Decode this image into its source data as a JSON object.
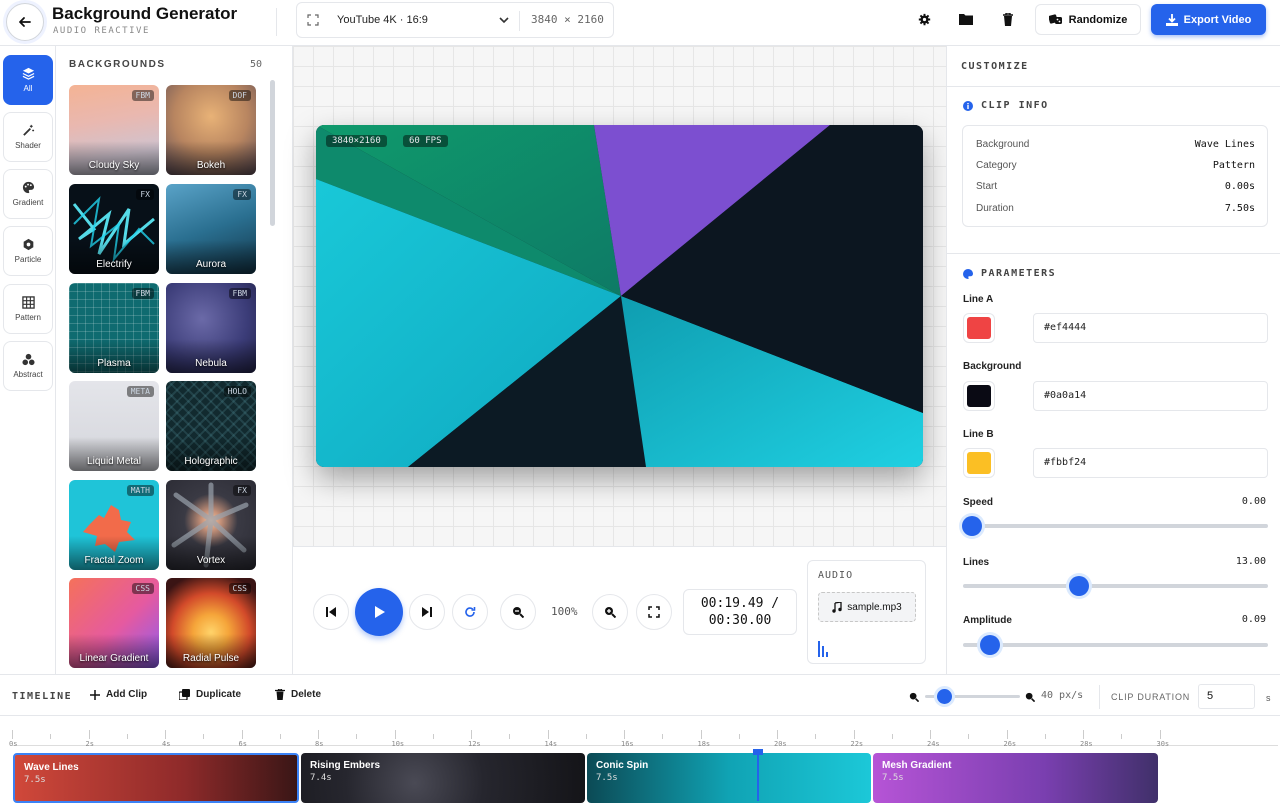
{
  "header": {
    "title": "Background Generator",
    "subtitle": "AUDIO REACTIVE",
    "preset": "YouTube 4K · 16:9",
    "resolution": "3840 × 2160",
    "randomize_label": "Randomize",
    "export_label": "Export Video"
  },
  "categories": [
    {
      "label": "All",
      "icon": "layers-icon",
      "active": true
    },
    {
      "label": "Shader",
      "icon": "wand-icon"
    },
    {
      "label": "Gradient",
      "icon": "palette-icon"
    },
    {
      "label": "Particle",
      "icon": "atom-icon"
    },
    {
      "label": "Pattern",
      "icon": "grid-icon"
    },
    {
      "label": "Abstract",
      "icon": "shapes-icon"
    }
  ],
  "backgrounds": {
    "title": "BACKGROUNDS",
    "count": "50",
    "items": [
      {
        "name": "Cloudy Sky",
        "tag": "FBM"
      },
      {
        "name": "Bokeh",
        "tag": "DOF"
      },
      {
        "name": "Electrify",
        "tag": "FX"
      },
      {
        "name": "Aurora",
        "tag": "FX"
      },
      {
        "name": "Plasma",
        "tag": "FBM"
      },
      {
        "name": "Nebula",
        "tag": "FBM"
      },
      {
        "name": "Liquid Metal",
        "tag": "META"
      },
      {
        "name": "Holographic",
        "tag": "HOLO"
      },
      {
        "name": "Fractal Zoom",
        "tag": "MATH"
      },
      {
        "name": "Vortex",
        "tag": "FX"
      },
      {
        "name": "Linear Gradient",
        "tag": "CSS"
      },
      {
        "name": "Radial Pulse",
        "tag": "CSS"
      }
    ]
  },
  "preview": {
    "res_badge": "3840×2160",
    "fps_badge": "60 FPS"
  },
  "playback": {
    "zoom": "100%",
    "current_time": "00:19.49 /",
    "total_time": "00:30.00",
    "audio_title": "AUDIO",
    "audio_file": "sample.mp3"
  },
  "customize": {
    "title": "CUSTOMIZE",
    "clip_info_title": "CLIP INFO",
    "clip_info": [
      {
        "label": "Background",
        "value": "Wave Lines"
      },
      {
        "label": "Category",
        "value": "Pattern"
      },
      {
        "label": "Start",
        "value": "0.00s"
      },
      {
        "label": "Duration",
        "value": "7.50s"
      }
    ],
    "params_title": "PARAMETERS",
    "colors": [
      {
        "label": "Line A",
        "hex": "#ef4444"
      },
      {
        "label": "Background",
        "hex": "#0a0a14"
      },
      {
        "label": "Line B",
        "hex": "#fbbf24"
      }
    ],
    "sliders": [
      {
        "label": "Speed",
        "value": "0.00",
        "fraction": 0.03
      },
      {
        "label": "Lines",
        "value": "13.00",
        "fraction": 0.38
      },
      {
        "label": "Amplitude",
        "value": "0.09",
        "fraction": 0.09
      }
    ]
  },
  "timeline": {
    "title": "TIMELINE",
    "add_clip": "Add Clip",
    "duplicate": "Duplicate",
    "delete": "Delete",
    "zoom_fraction": 0.2,
    "scale": "40 px/s",
    "clip_duration_label": "CLIP DURATION",
    "clip_duration_value": "5",
    "clip_duration_unit": "s",
    "ruler": [
      "0s",
      "2s",
      "4s",
      "6s",
      "8s",
      "10s",
      "12s",
      "14s",
      "16s",
      "18s",
      "20s",
      "22s",
      "24s",
      "26s",
      "28s",
      "30s"
    ],
    "clips": [
      {
        "name": "Wave Lines",
        "duration": "7.5s"
      },
      {
        "name": "Rising Embers",
        "duration": "7.4s"
      },
      {
        "name": "Conic Spin",
        "duration": "7.5s"
      },
      {
        "name": "Mesh Gradient",
        "duration": "7.5s"
      }
    ]
  },
  "colors": {
    "accent": "#2563eb"
  }
}
